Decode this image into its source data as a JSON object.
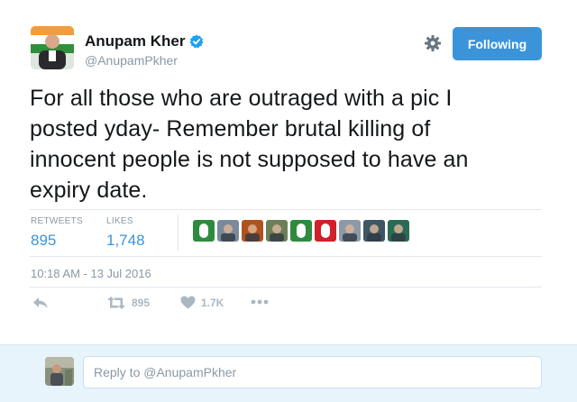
{
  "author": {
    "name": "Anupam Kher",
    "handle": "@AnupamPkher",
    "verified": true,
    "verified_color": "#1da1f2"
  },
  "header": {
    "follow_label": "Following",
    "follow_color": "#3b94d9",
    "settings_icon": "gear-icon"
  },
  "tweet": {
    "text_lines": [
      "For all those who are outraged with a pic I",
      "posted yday- Remember brutal killing of",
      "innocent people is not supposed to have an",
      "expiry date."
    ]
  },
  "stats": {
    "retweets_label": "RETWEETS",
    "retweets_value": "895",
    "likes_label": "LIKES",
    "likes_value": "1,748",
    "value_color": "#3b94d9"
  },
  "likers": [
    {
      "icon": "liker-avatar-green",
      "color": "#2e8b3e"
    },
    {
      "icon": "liker-avatar-photo",
      "color": "#7a8a9a"
    },
    {
      "icon": "liker-avatar-photo",
      "color": "#b0521e"
    },
    {
      "icon": "liker-avatar-photo",
      "color": "#6d7f5a"
    },
    {
      "icon": "liker-avatar-green",
      "color": "#2e8b3e"
    },
    {
      "icon": "liker-avatar-red",
      "color": "#d0202a"
    },
    {
      "icon": "liker-avatar-photo",
      "color": "#8c9aa8"
    },
    {
      "icon": "liker-avatar-photo",
      "color": "#3f5663"
    },
    {
      "icon": "liker-avatar-photo",
      "color": "#2a6b56"
    }
  ],
  "timestamp": "10:18 AM - 13 Jul 2016",
  "actions": {
    "reply_icon": "reply-icon",
    "retweet_icon": "retweet-icon",
    "retweet_count": "895",
    "like_icon": "heart-icon",
    "like_count": "1.7K",
    "more_icon": "more-icon"
  },
  "reply": {
    "placeholder": "Reply to @AnupamPkher"
  }
}
